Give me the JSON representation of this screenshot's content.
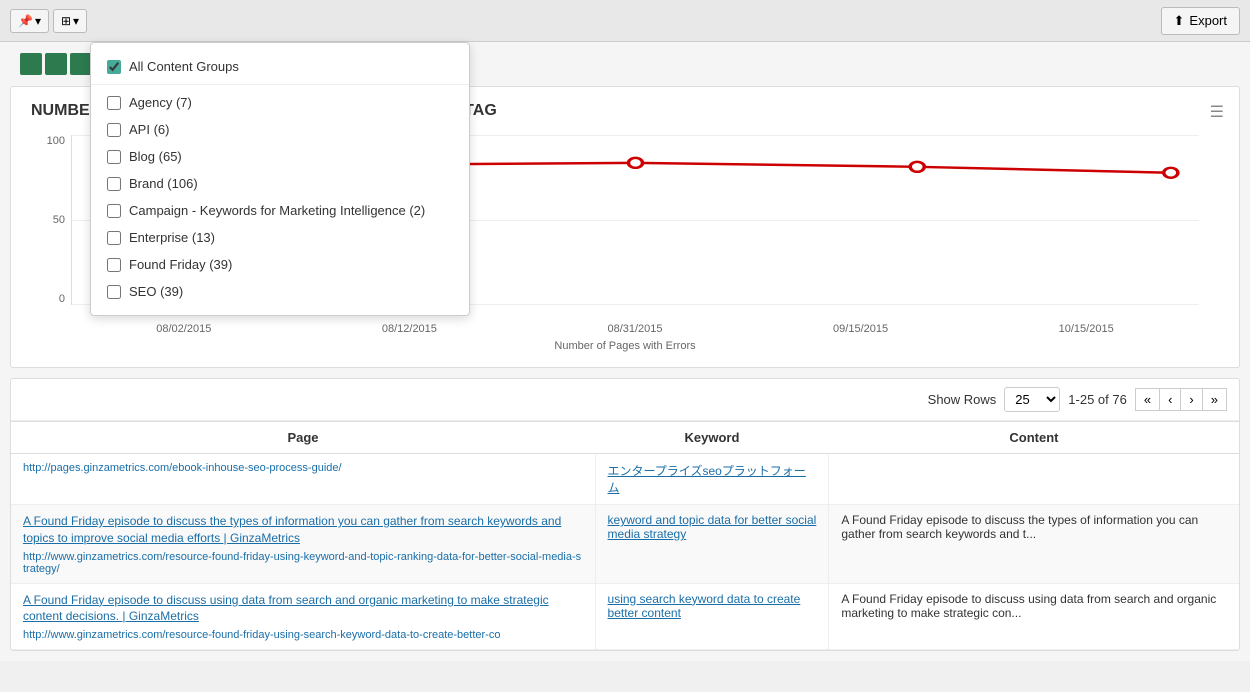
{
  "toolbar": {
    "export_label": "Export",
    "filter_icon": "≡",
    "dropdown_arrow": "▾",
    "pin_icon": "📌"
  },
  "dropdown": {
    "title": "All Content Groups",
    "items": [
      {
        "id": "all",
        "label": "All Content Groups",
        "checked": true
      },
      {
        "id": "agency",
        "label": "Agency (7)",
        "checked": false
      },
      {
        "id": "api",
        "label": "API (6)",
        "checked": false
      },
      {
        "id": "blog",
        "label": "Blog (65)",
        "checked": false
      },
      {
        "id": "brand",
        "label": "Brand (106)",
        "checked": false
      },
      {
        "id": "campaign",
        "label": "Campaign - Keywords for Marketing Intelligence (2)",
        "checked": false
      },
      {
        "id": "enterprise",
        "label": "Enterprise (13)",
        "checked": false
      },
      {
        "id": "found_friday",
        "label": "Found Friday (39)",
        "checked": false
      },
      {
        "id": "seo",
        "label": "SEO (39)",
        "checked": false
      }
    ]
  },
  "green_squares": [
    1,
    2,
    3,
    4,
    5,
    6
  ],
  "chart": {
    "title": "NUMBER OF PAGES WITH ERRORS IN THE HTML TITLE TAG",
    "y_labels": [
      "100",
      "50",
      "0"
    ],
    "x_labels": [
      "08/02/2015",
      "08/12/2015",
      "08/31/2015",
      "09/15/2015",
      "10/15/2015"
    ],
    "subtitle": "Number of Pages with Errors",
    "line_color": "#cc0000"
  },
  "table": {
    "show_rows_label": "Show Rows",
    "rows_options": [
      "25",
      "50",
      "100"
    ],
    "rows_selected": "25",
    "pagination_info": "1-25 of 76",
    "columns": [
      "Page",
      "Keyword",
      "Content"
    ],
    "rows": [
      {
        "page_title": "",
        "page_url": "http://pages.ginzametrics.com/ebook-inhouse-seo-process-guide/",
        "keyword": "エンタープライズseoプラットフォーム",
        "content": ""
      },
      {
        "page_title": "A Found Friday episode to discuss the types of information you can gather from search keywords and topics to improve social media efforts | GinzaMetrics",
        "page_url": "http://www.ginzametrics.com/resource-found-friday-using-keyword-and-topic-ranking-data-for-better-social-media-strategy/",
        "keyword": "keyword and topic data for better social media strategy",
        "content": "A Found Friday episode to discuss the types of information you can gather from search keywords and t..."
      },
      {
        "page_title": "A Found Friday episode to discuss using data from search and organic marketing to make strategic content decisions. | GinzaMetrics",
        "page_url": "http://www.ginzametrics.com/resource-found-friday-using-search-keyword-data-to-create-better-co",
        "keyword": "using search keyword data to create better content",
        "content": "A Found Friday episode to discuss using data from search and organic marketing to make strategic con..."
      }
    ]
  }
}
